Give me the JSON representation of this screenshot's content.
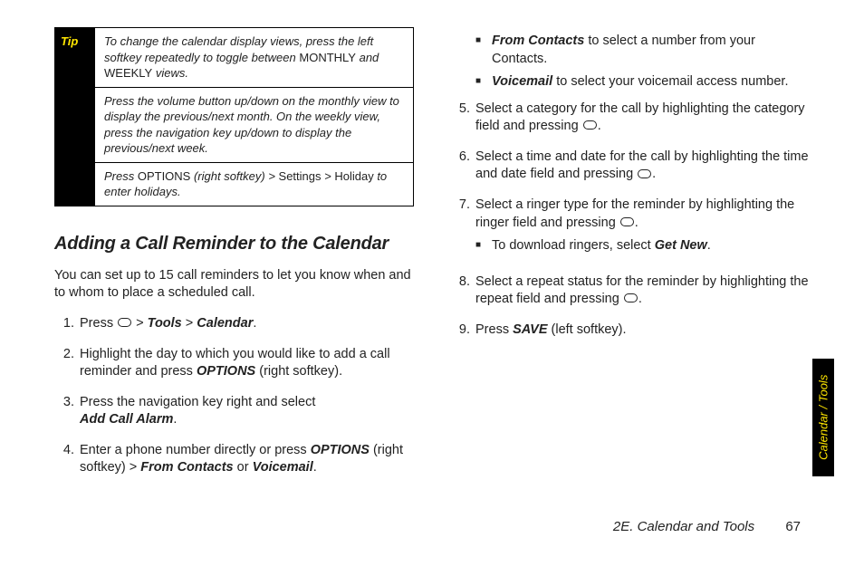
{
  "tip": {
    "label": "Tip",
    "rows": [
      {
        "pre": "To change the calendar display views, press the left softkey repeatedly to toggle between ",
        "k1": "MONTHLY",
        "mid": " and ",
        "k2": "WEEKLY",
        "post": " views."
      },
      {
        "text": "Press the volume button up/down on the monthly view to display the previous/next month. On the weekly view, press the navigation key up/down to display the previous/next week."
      },
      {
        "pre": "Press ",
        "k1": "OPTIONS",
        "mid": " (right softkey) > ",
        "k2": "Settings",
        "mid2": " > ",
        "k3": "Holiday",
        "post": " to enter holidays."
      }
    ]
  },
  "section": {
    "heading": "Adding a Call Reminder to the Calendar",
    "intro": "You can set up to 15 call reminders to let you know when and to whom to place a scheduled call."
  },
  "steps": {
    "s1": {
      "num": "1.",
      "pre": "Press ",
      "mid": " > ",
      "tools": "Tools",
      "mid2": " > ",
      "cal": "Calendar",
      "post": "."
    },
    "s2": {
      "num": "2.",
      "pre": "Highlight the day to which you would like to add a call reminder and press ",
      "opt": "OPTIONS",
      "post": " (right softkey)."
    },
    "s3": {
      "num": "3.",
      "pre": "Press the navigation key right and select ",
      "add": "Add Call Alarm",
      "post": "."
    },
    "s4": {
      "num": "4.",
      "pre": "Enter a phone number directly or press ",
      "opt": "OPTIONS",
      "mid": " (right softkey) > ",
      "fc": "From Contacts",
      "or": " or ",
      "vm": "Voicemail",
      "post": "."
    },
    "s4a": {
      "fc": "From Contacts",
      "text": " to select a number from your Contacts."
    },
    "s4b": {
      "vm": "Voicemail",
      "text": " to select your voicemail access number."
    },
    "s5": {
      "num": "5.",
      "pre": "Select a category for the call by highlighting the category field  and pressing ",
      "post": "."
    },
    "s6": {
      "num": "6.",
      "pre": "Select a time and date for the call  by highlighting the time and date field and pressing ",
      "post": "."
    },
    "s7": {
      "num": "7.",
      "pre": "Select a ringer type for the reminder by highlighting the ringer field and pressing ",
      "post": "."
    },
    "s7a": {
      "text": "To download ringers, select ",
      "gn": "Get New",
      "post": "."
    },
    "s8": {
      "num": "8.",
      "pre": "Select a repeat status for the reminder by highlighting the repeat field and pressing ",
      "post": "."
    },
    "s9": {
      "num": "9.",
      "pre": "Press ",
      "save": "SAVE",
      "post": " (left softkey)."
    }
  },
  "sidetab": "Calendar / Tools",
  "footer": {
    "section": "2E. Calendar and Tools",
    "page": "67"
  }
}
